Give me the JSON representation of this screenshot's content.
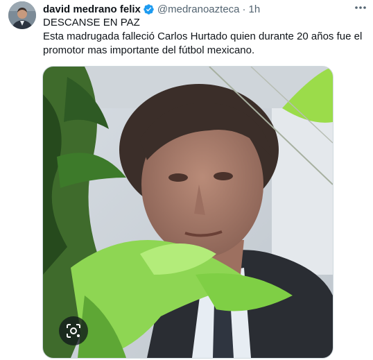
{
  "tweet": {
    "author_name": "david medrano felix",
    "handle": "@medranoazteca",
    "separator": "·",
    "time": "1h",
    "text_line1": "DESCANSE EN PAZ",
    "text_line2": "Esta madrugada falleció Carlos Hurtado quien durante 20 años fue el promotor mas importante del fútbol mexicano."
  },
  "icons": {
    "verified": "verified-badge-icon",
    "more": "more-options-icon",
    "lens": "lens-search-icon"
  },
  "colors": {
    "verified_blue": "#1d9bf0",
    "secondary_text": "#536471",
    "primary_text": "#0f1419"
  }
}
